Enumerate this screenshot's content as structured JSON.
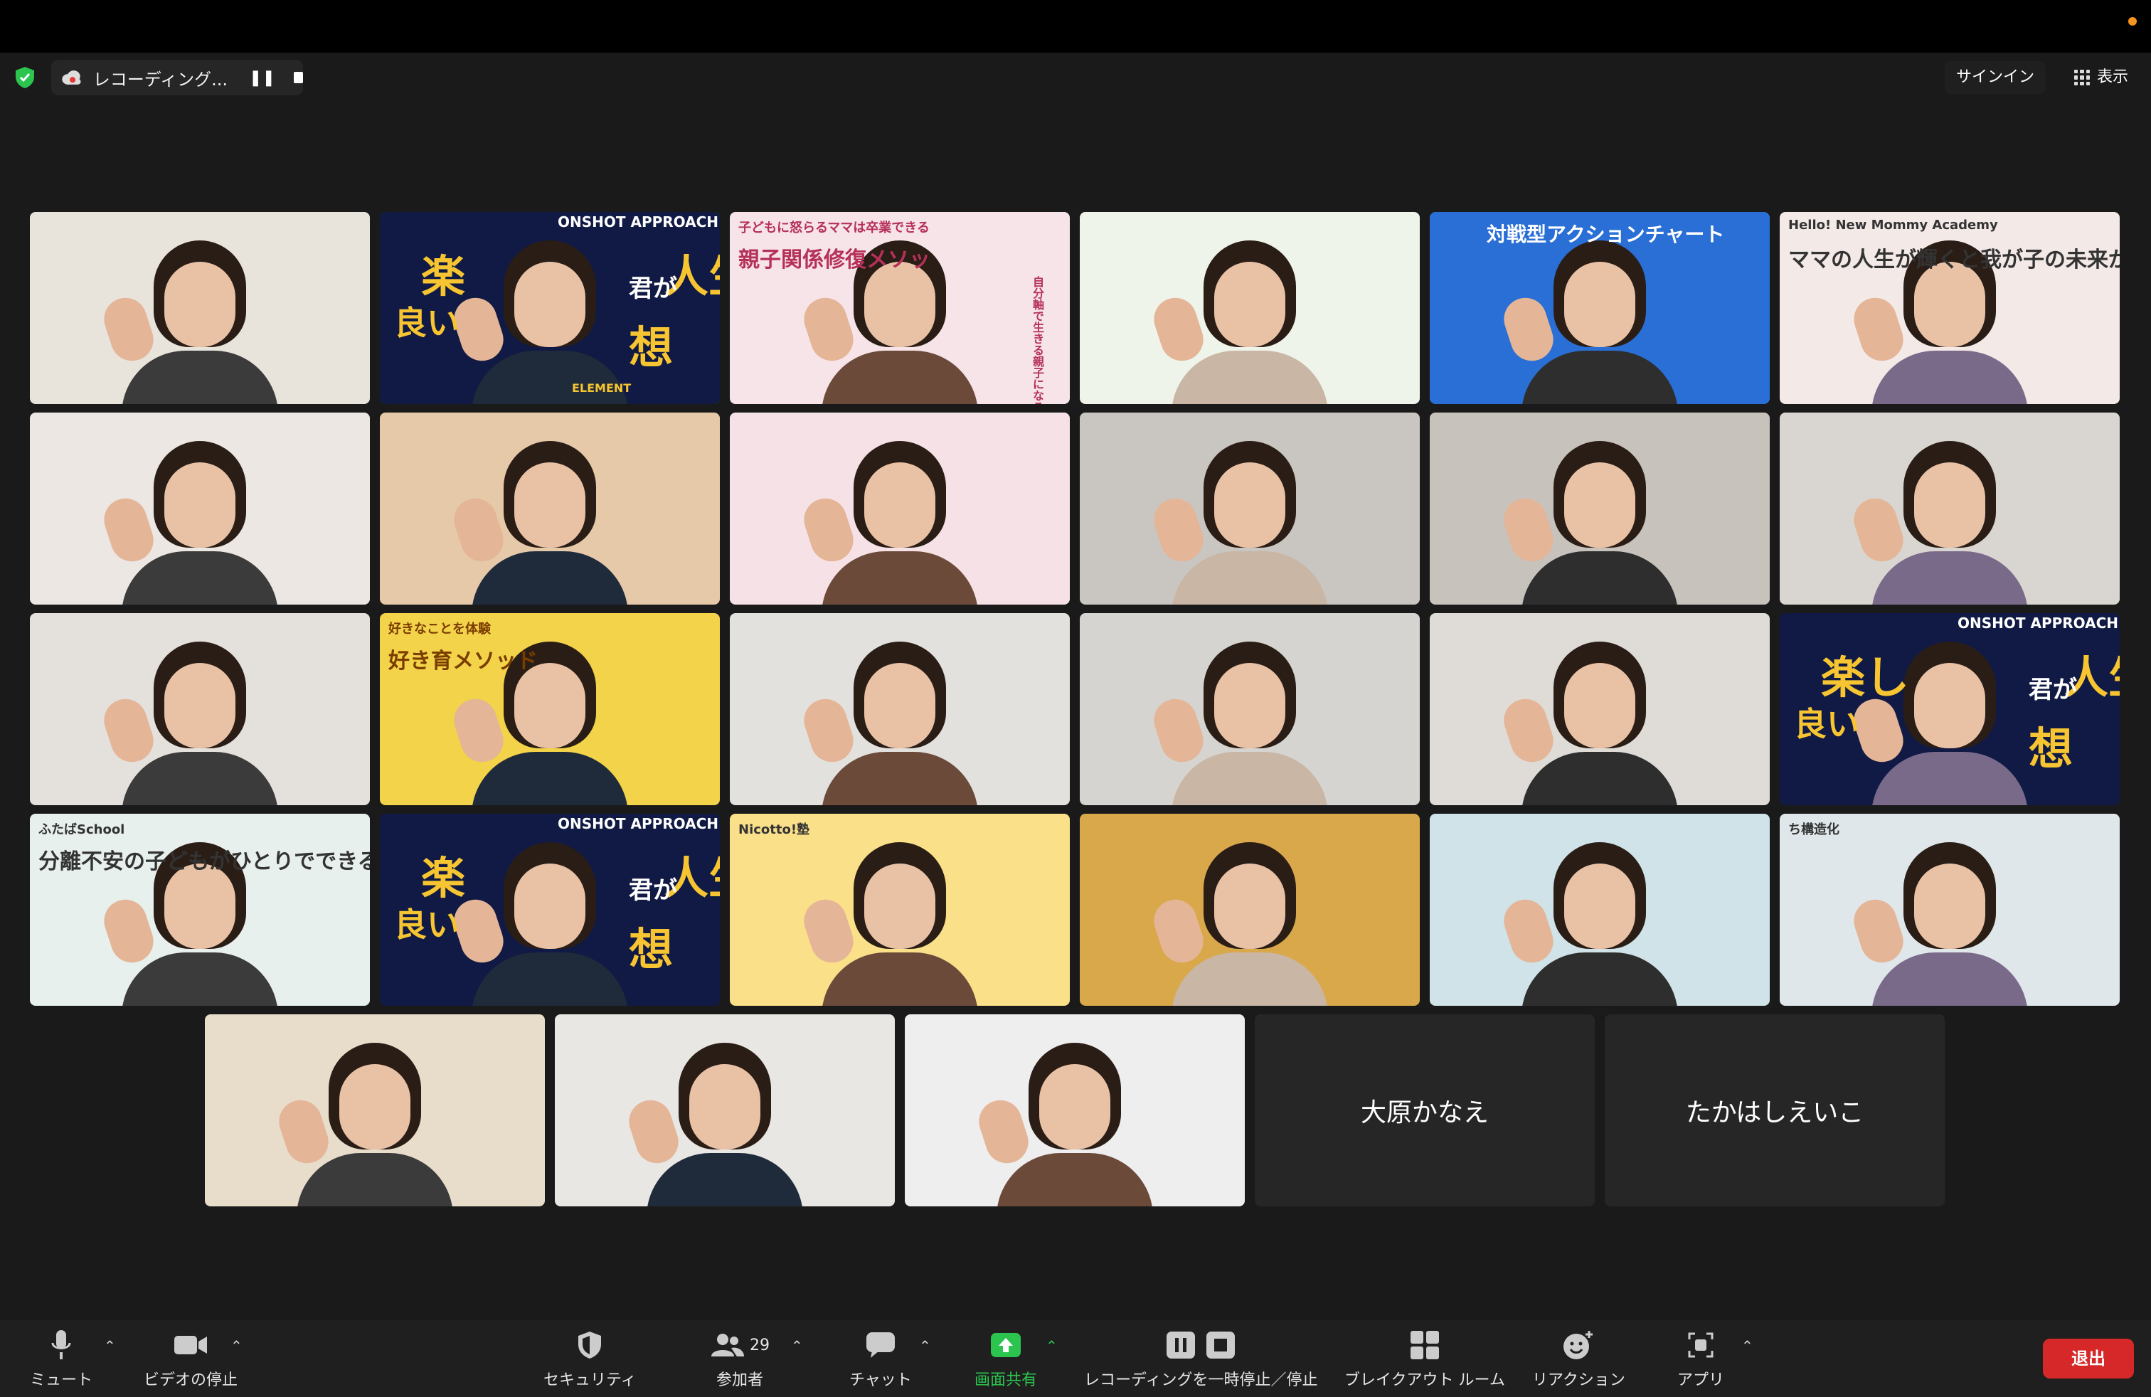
{
  "header": {
    "recording_label": "レコーディング...",
    "signin_label": "サインイン",
    "view_label": "表示"
  },
  "participants": [
    {
      "row": 1,
      "col": 1,
      "bg": "#e8e4dc"
    },
    {
      "row": 1,
      "col": 2,
      "bg": "#101a44",
      "active": true,
      "overlay": [
        "ONSHOT APPROACH TRAINER",
        "人生",
        "君が",
        "想",
        "楽",
        "良い",
        "ELEMENT"
      ]
    },
    {
      "row": 1,
      "col": 3,
      "bg": "#f7e4e8",
      "overlay": [
        "子どもに怒らるママは卒業できる",
        "親子関係修復メソッ",
        "自分軸で生きる親子になる"
      ]
    },
    {
      "row": 1,
      "col": 4,
      "bg": "#eef4ea"
    },
    {
      "row": 1,
      "col": 5,
      "bg": "#2a6fd6",
      "overlay": [
        "対戦型アクションチャート"
      ]
    },
    {
      "row": 1,
      "col": 6,
      "bg": "#f3e9e6",
      "overlay": [
        "Hello! New Mommy Academy",
        "ママの人生が輝くと我が子の未来がもっと輝く"
      ]
    },
    {
      "row": 2,
      "col": 1,
      "bg": "#ece7e2"
    },
    {
      "row": 2,
      "col": 2,
      "bg": "#e6c9a8"
    },
    {
      "row": 2,
      "col": 3,
      "bg": "#f6e2e6"
    },
    {
      "row": 2,
      "col": 4,
      "bg": "#c9c6c2"
    },
    {
      "row": 2,
      "col": 5,
      "bg": "#c8c2bc"
    },
    {
      "row": 2,
      "col": 6,
      "bg": "#d9d6d1"
    },
    {
      "row": 3,
      "col": 1,
      "bg": "#e4e1dc"
    },
    {
      "row": 3,
      "col": 2,
      "bg": "#f3d34a",
      "overlay": [
        "好きなことを体験",
        "好き育メソッド"
      ]
    },
    {
      "row": 3,
      "col": 3,
      "bg": "#e3e1dd"
    },
    {
      "row": 3,
      "col": 4,
      "bg": "#d6d4d0"
    },
    {
      "row": 3,
      "col": 5,
      "bg": "#dfdcd8"
    },
    {
      "row": 3,
      "col": 6,
      "bg": "#101a44",
      "overlay": [
        "ONSHOT APPROACH TRANER",
        "人生",
        "君が",
        "想",
        "楽し",
        "良い"
      ]
    },
    {
      "row": 4,
      "col": 1,
      "bg": "#e7f0ec",
      "overlay": [
        "ふたばSchool",
        "分離不安の子どもがひとりでできるようになる！"
      ]
    },
    {
      "row": 4,
      "col": 2,
      "bg": "#101a44",
      "overlay": [
        "ONSHOT APPROACH TRANER",
        "人生",
        "君が",
        "想",
        "楽",
        "良い"
      ]
    },
    {
      "row": 4,
      "col": 3,
      "bg": "#fbe08a",
      "overlay": [
        "Nicotto!塾"
      ]
    },
    {
      "row": 4,
      "col": 4,
      "bg": "#d9a84a"
    },
    {
      "row": 4,
      "col": 5,
      "bg": "#cfe3e8"
    },
    {
      "row": 4,
      "col": 6,
      "bg": "#dfe7ea",
      "overlay": [
        "ち構造化"
      ]
    },
    {
      "row": 5,
      "col": 1,
      "bg": "#e8dccb"
    },
    {
      "row": 5,
      "col": 2,
      "bg": "#e9e7e4"
    },
    {
      "row": 5,
      "col": 3,
      "bg": "#eeeeee"
    },
    {
      "row": 5,
      "col": 4,
      "name": "大原かなえ"
    },
    {
      "row": 5,
      "col": 5,
      "name": "たかはしえいこ"
    }
  ],
  "toolbar": {
    "mute_label": "ミュート",
    "video_label": "ビデオの停止",
    "security_label": "セキュリティ",
    "participants_label": "参加者",
    "participants_count": "29",
    "chat_label": "チャット",
    "share_label": "画面共有",
    "pause_recording_label": "レコーディングを一時停止／停止",
    "breakout_label": "ブレイクアウト ルーム",
    "reactions_label": "リアクション",
    "apps_label": "アプリ",
    "leave_label": "退出"
  },
  "colors": {
    "active_speaker": "#26c04a",
    "share_green": "#2bc44f",
    "leave_red": "#d62828"
  }
}
